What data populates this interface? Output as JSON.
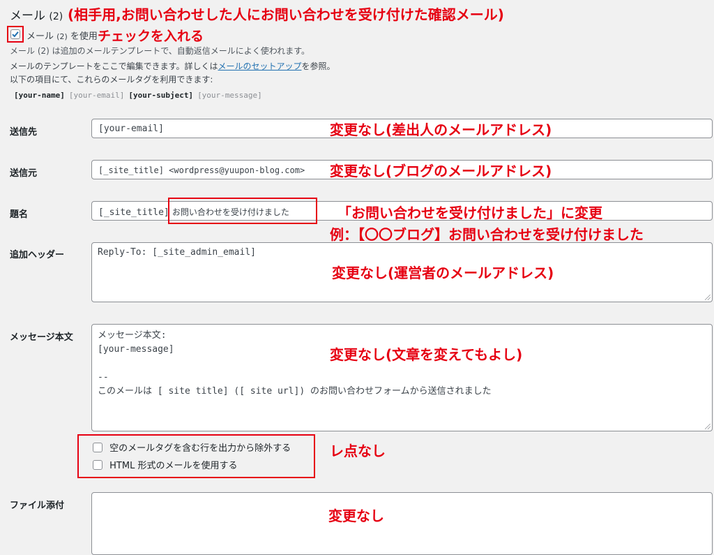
{
  "section": {
    "title": "メール",
    "title_count": "(2)",
    "annotation": "(相手用,お問い合わせした人にお問い合わせを受け付けた確認メール)"
  },
  "use_mail2": {
    "checked": true,
    "label_prefix": "メール",
    "label_count": "(2)",
    "label_suffix": "を使用",
    "annotation": "チェックを入れる"
  },
  "notes": {
    "line1": "メール (2) は追加のメールテンプレートで、自動返信メールによく使われます。",
    "line2_before": "メールのテンプレートをここで編集できます。詳しくは",
    "line2_link": "メールのセットアップ",
    "line2_after": "を参照。",
    "line3": "以下の項目にて、これらのメールタグを利用できます:"
  },
  "mail_tags": [
    {
      "text": "[your-name]",
      "bold": true
    },
    {
      "text": "[your-email]",
      "bold": false
    },
    {
      "text": "[your-subject]",
      "bold": true
    },
    {
      "text": "[your-message]",
      "bold": false
    }
  ],
  "fields": {
    "to": {
      "label": "送信先",
      "value": "[your-email]",
      "annotation": "変更なし(差出人のメールアドレス)"
    },
    "from": {
      "label": "送信元",
      "value": "[_site_title] <wordpress@yuupon-blog.com>",
      "annotation": "変更なし(ブログのメールアドレス)"
    },
    "subject": {
      "label": "題名",
      "value_prefix": "[_site_title]",
      "value_rest": "お問い合わせを受け付けました",
      "annotation1": "「お問い合わせを受け付けました」に変更",
      "annotation2": "例：【〇〇ブログ】お問い合わせを受け付けました"
    },
    "headers": {
      "label": "追加ヘッダー",
      "value": "Reply-To: [_site_admin_email]",
      "annotation": "変更なし(運営者のメールアドレス)"
    },
    "body": {
      "label": "メッセージ本文",
      "lines": [
        "メッセージ本文:",
        "[your-message]",
        "",
        "--",
        "このメールは [ site title] ([ site url]) のお問い合わせフォームから送信されました"
      ],
      "annotation": "変更なし(文章を変えてもよし)"
    },
    "attachments": {
      "label": "ファイル添付",
      "value": "",
      "annotation": "変更なし"
    }
  },
  "options": {
    "exclude_blank": {
      "label": "空のメールタグを含む行を出力から除外する",
      "checked": false
    },
    "use_html": {
      "label": "HTML 形式のメールを使用する",
      "checked": false
    },
    "annotation": "レ点なし"
  },
  "colors": {
    "annotation_red": "#e60012",
    "checkbox_blue": "#2271b1",
    "link_blue": "#2271b1",
    "background": "#f1f1f1"
  }
}
